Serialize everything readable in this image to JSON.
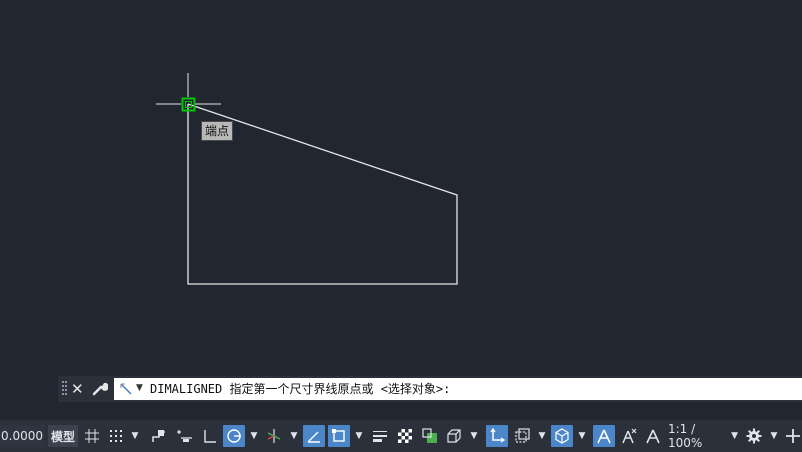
{
  "tooltip": {
    "snap_label": "端点"
  },
  "command": {
    "prompt": "DIMALIGNED 指定第一个尺寸界线原点或 <选择对象>:"
  },
  "status_bar": {
    "coordinates": "0.0000",
    "model_tab": "模型",
    "annotation_scale": "1:1 / 100%",
    "icons": [
      "grid-icon",
      "snap-icon",
      "infer-constraints-icon",
      "dynamic-input-icon",
      "ortho-icon",
      "polar-tracking-icon",
      "isodraft-icon",
      "object-snap-tracking-icon",
      "object-snap-icon",
      "lineweight-icon",
      "transparency-icon",
      "selection-cycling-icon",
      "3d-object-snap-icon",
      "dynamic-ucs-icon",
      "selection-filter-icon",
      "gizmo-icon",
      "annotation-visibility-icon",
      "auto-scale-icon",
      "annotation-scale-icon",
      "workspace-gear-icon",
      "customize-icon"
    ],
    "active_toggles": [
      "polar-tracking",
      "object-snap-tracking",
      "object-snap",
      "dynamic-ucs",
      "gizmo",
      "annotation-visibility"
    ]
  },
  "colors": {
    "canvas_bg": "#212630",
    "panel_bg": "#2b303a",
    "active_toggle": "#4a86c8",
    "snap_marker": "#00c800",
    "geometry": "#ffffff"
  }
}
